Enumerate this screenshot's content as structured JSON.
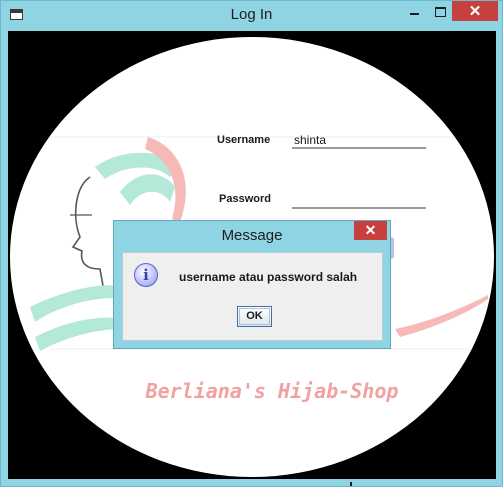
{
  "window": {
    "title": "Log In",
    "controls": {
      "minimize_icon": "minimize-icon",
      "maximize_icon": "maximize-icon",
      "close_icon": "close-icon"
    }
  },
  "login_form": {
    "username_label": "Username",
    "username_value": "shinta",
    "password_label": "Password",
    "password_value": ""
  },
  "branding": {
    "shop_name": "Berliana's Hijab-Shop",
    "accent_pink": "#f2a0a0",
    "accent_mint": "#b4e8d8"
  },
  "message_dialog": {
    "title": "Message",
    "icon": "info-icon",
    "text": "username atau password salah",
    "ok_label": "OK"
  },
  "colors": {
    "frame": "#8fd4e2",
    "close_button": "#c74040",
    "content_bg": "#000000"
  }
}
